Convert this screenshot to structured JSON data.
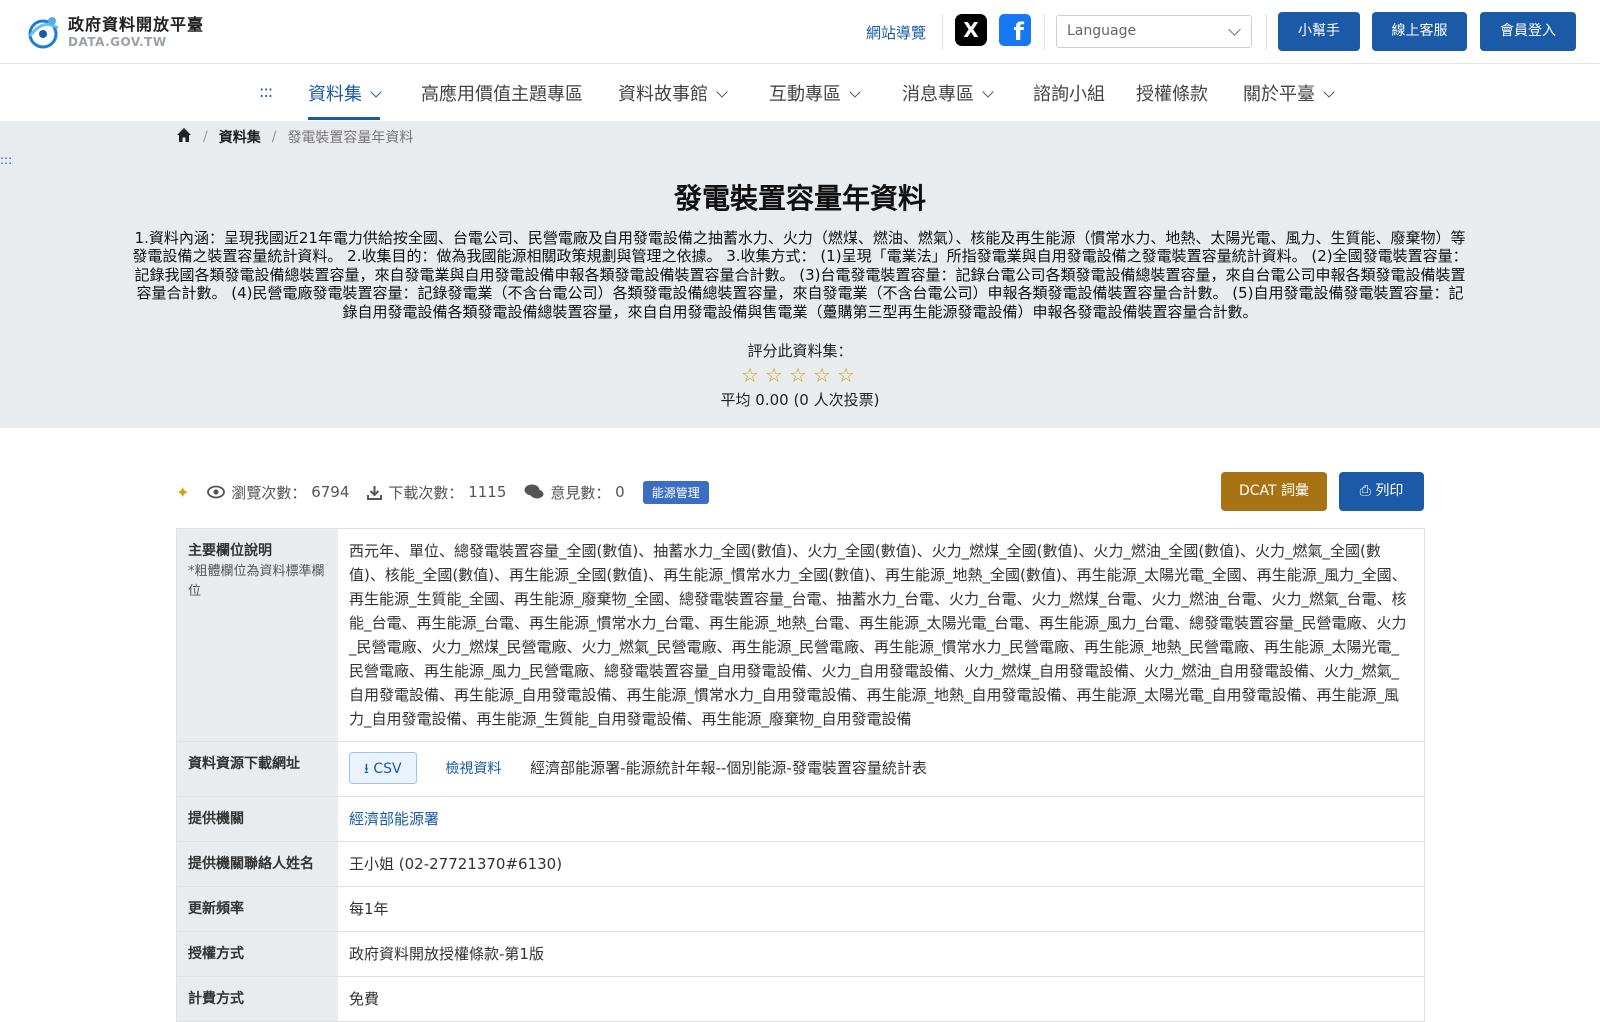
{
  "header": {
    "logo_title": "政府資料開放平臺",
    "logo_sub": "DATA.GOV.TW",
    "sitemap": "網站導覽",
    "x_icon": "X",
    "fb_icon": "f",
    "language_placeholder": "Language",
    "buttons": {
      "helper": "小幫手",
      "support": "線上客服",
      "login": "會員登入"
    }
  },
  "nav": {
    "accesskey": ":::",
    "items": [
      "資料集",
      "高應用價值主題專區",
      "資料故事館",
      "互動專區",
      "消息專區",
      "諮詢小組",
      "授權條款",
      "關於平臺"
    ]
  },
  "breadcrumb": {
    "section": "資料集",
    "current": "發電裝置容量年資料"
  },
  "hero": {
    "accesskey": ":::",
    "title": "發電裝置容量年資料",
    "description": "1.資料內涵：呈現我國近21年電力供給按全國、台電公司、民營電廠及自用發電設備之抽蓄水力、火力（燃煤、燃油、燃氣）、核能及再生能源（慣常水力、地熱、太陽光電、風力、生質能、廢棄物）等發電設備之裝置容量統計資料。 2.收集目的：做為我國能源相關政策規劃與管理之依據。 3.收集方式： (1)呈現「電業法」所指發電業與自用發電設備之發電裝置容量統計資料。 (2)全國發電裝置容量：記錄我國各類發電設備總裝置容量，來自發電業與自用發電設備申報各類發電設備裝置容量合計數。 (3)台電發電裝置容量：記錄台電公司各類發電設備總裝置容量，來自台電公司申報各類發電設備裝置容量合計數。 (4)民營電廠發電裝置容量：記錄發電業（不含台電公司）各類發電設備總裝置容量，來自發電業（不含台電公司）申報各類發電設備裝置容量合計數。 (5)自用發電設備發電裝置容量：記錄自用發電設備各類發電設備總裝置容量，來自自用發電設備與售電業（躉購第三型再生能源發電設備）申報各發電設備裝置容量合計數。",
    "rate_label": "評分此資料集：",
    "stars": [
      "☆",
      "☆",
      "☆",
      "☆",
      "☆"
    ],
    "average": "平均 0.00 (0 人次投票)"
  },
  "stats": {
    "views_label": "瀏覽次數：",
    "views": "6794",
    "downloads_label": "下載次數：",
    "downloads": "1115",
    "comments_label": "意見數：",
    "comments": "0",
    "tag": "能源管理",
    "dcat": "DCAT 詞彙",
    "print": "列印"
  },
  "table": {
    "fields_label": "主要欄位說明",
    "fields_note": "*粗體欄位為資料標準欄位",
    "fields_value": "西元年、單位、總發電裝置容量_全國(數值)、抽蓄水力_全國(數值)、火力_全國(數值)、火力_燃煤_全國(數值)、火力_燃油_全國(數值)、火力_燃氣_全國(數值)、核能_全國(數值)、再生能源_全國(數值)、再生能源_慣常水力_全國(數值)、再生能源_地熱_全國(數值)、再生能源_太陽光電_全國、再生能源_風力_全國、再生能源_生質能_全國、再生能源_廢棄物_全國、總發電裝置容量_台電、抽蓄水力_台電、火力_台電、火力_燃煤_台電、火力_燃油_台電、火力_燃氣_台電、核能_台電、再生能源_台電、再生能源_慣常水力_台電、再生能源_地熱_台電、再生能源_太陽光電_台電、再生能源_風力_台電、總發電裝置容量_民營電廠、火力_民營電廠、火力_燃煤_民營電廠、火力_燃氣_民營電廠、再生能源_民營電廠、再生能源_慣常水力_民營電廠、再生能源_地熱_民營電廠、再生能源_太陽光電_民營電廠、再生能源_風力_民營電廠、總發電裝置容量_自用發電設備、火力_自用發電設備、火力_燃煤_自用發電設備、火力_燃油_自用發電設備、火力_燃氣_自用發電設備、再生能源_自用發電設備、再生能源_慣常水力_自用發電設備、再生能源_地熱_自用發電設備、再生能源_太陽光電_自用發電設備、再生能源_風力_自用發電設備、再生能源_生質能_自用發電設備、再生能源_廢棄物_自用發電設備",
    "download_label": "資料資源下載網址",
    "csv": "CSV",
    "view_data": "檢視資料",
    "resource_desc": "經濟部能源署-能源統計年報--個別能源-發電裝置容量統計表",
    "provider_label": "提供機關",
    "provider": "經濟部能源署",
    "contact_label": "提供機關聯絡人姓名",
    "contact": "王小姐 (02-27721370#6130)",
    "frequency_label": "更新頻率",
    "frequency": "每1年",
    "license_label": "授權方式",
    "license": "政府資料開放授權條款-第1版",
    "fee_label": "計費方式",
    "fee": "免費"
  }
}
